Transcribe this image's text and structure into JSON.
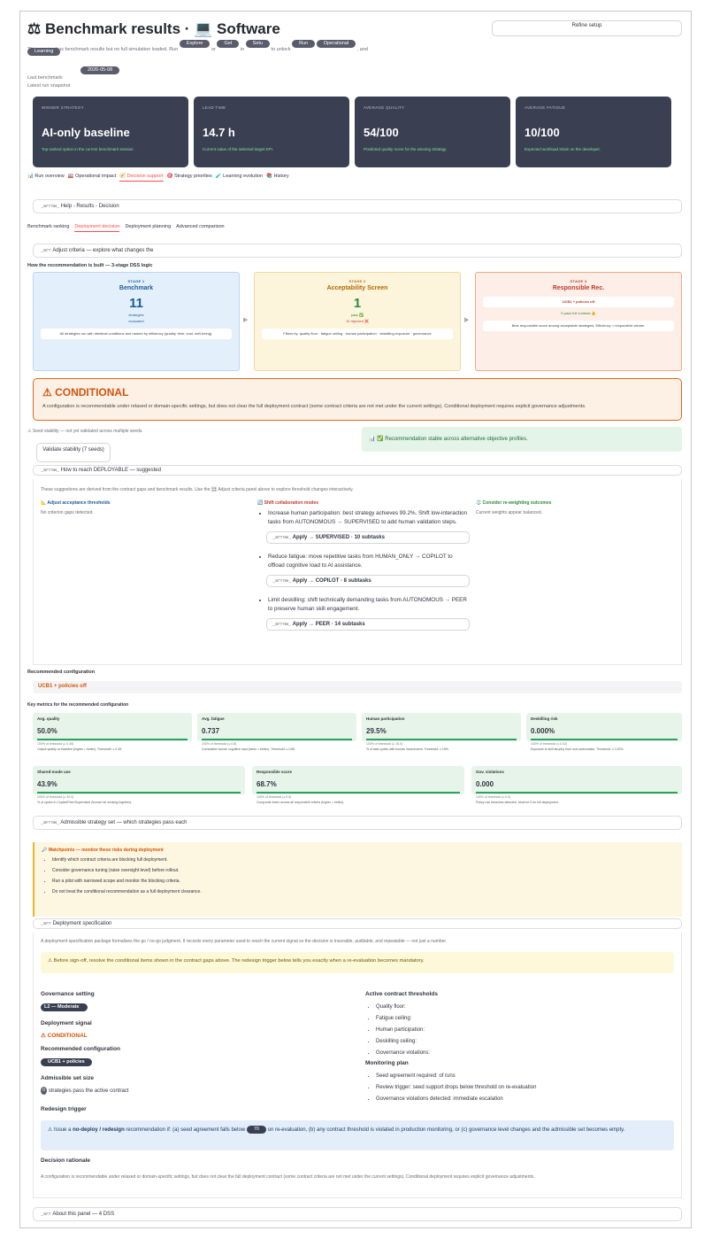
{
  "header": {
    "title": "⚖ Benchmark results · 💻 Software",
    "refine_label": "Refine setup",
    "info_prefix": "This session has benchmark results but no full simulation loaded. Run",
    "info_or": "or",
    "info_in": "in",
    "info_unlock": "to unlock",
    "info_and": ", and",
    "pills": [
      "Explore",
      "Get",
      "Setu",
      "Run",
      "Operational",
      "Learning"
    ],
    "date": "2026-05-08",
    "last_benchmark": "Last benchmark:",
    "latest": "Latest run snapshot"
  },
  "kpis": [
    {
      "label": "WINNER STRATEGY",
      "value": "AI-only baseline",
      "sub": "Top-ranked option in the current benchmark session."
    },
    {
      "label": "LEAD TIME",
      "value": "14.7 h",
      "sub": "Current value of the selected target KPI."
    },
    {
      "label": "AVERAGE QUALITY",
      "value": "54/100",
      "sub": "Predicted quality score for the winning strategy."
    },
    {
      "label": "AVERAGE FATIGUE",
      "value": "10/100",
      "sub": "Expected workload strain on the developer."
    }
  ],
  "main_tabs": [
    "📊 Run overview",
    "🏭 Operational impact",
    "🧭 Decision support",
    "🎯 Strategy priorities",
    "🧪 Learning evolution",
    "📚 History"
  ],
  "exp1": {
    "arrow": "_arrow_",
    "label": "Help - Results - Decision"
  },
  "sub_tabs": [
    "Benchmark ranking",
    "Deployment decision",
    "Deployment planning",
    "Advanced comparison"
  ],
  "exp2": {
    "arrow": "_arr",
    "label": "Adjust criteria — explore what changes the"
  },
  "dss_title": "How the recommendation is built — 3-stage DSS logic",
  "stages": [
    {
      "label": "STAGE 1",
      "name": "Benchmark",
      "num": "11",
      "l1": "strategies",
      "l2": "evaluated",
      "desc": "All strategies run with identical conditions and ranked by efficiency (quality, time, cost, well-being)."
    },
    {
      "label": "STAGE 2",
      "name": "Acceptability Screen",
      "num": "1",
      "l1": "pass ✅",
      "l2": "10 rejected ❌",
      "desc": "Filters by: quality floor · fatigue ceiling · human participation · deskilling exposure · governance"
    },
    {
      "label": "STAGE 3",
      "name": "Responsible Rec.",
      "l1": "UCB1 + policies off",
      "l2": "0 pass full contract ⚠️",
      "desc": "Best responsible score among acceptable strategies. Efficiency × responsible winner."
    }
  ],
  "conditional": {
    "title": "⚠ CONDITIONAL",
    "text": "A configuration is recommendable under relaxed or domain-specific settings, but does not clear the full deployment contract (some contract criteria are not met under the current settings). Conditional deployment requires explicit governance adjustments."
  },
  "seed": {
    "text": "⚠ Seed stability — not yet validated across multiple seeds.",
    "button": "Validate stability (7 seeds)",
    "stable": "📊 ✅ Recommendation stable across alternative objective profiles."
  },
  "exp3": {
    "arrow": "_arrow_",
    "label": "How to reach DEPLOYABLE — suggested"
  },
  "sugg": {
    "intro": "These suggestions are derived from the contract gaps and benchmark results. Use the 🎛 Adjust criteria panel above to explore threshold changes interactively.",
    "c1_title": "📐 Adjust acceptance thresholds",
    "c1_text": "No criterion gaps detected.",
    "c2_title": "🔄 Shift collaboration modes",
    "items": [
      {
        "text": "Increase human participation: best strategy achieves 99.2%. Shift low-interaction tasks from AUTONOMOUS → SUPERVISED to add human validation steps.",
        "exp": "_arrow_",
        "exp_label": "Apply → SUPERVISED · 10 subtasks"
      },
      {
        "text": "Reduce fatigue: move repetitive tasks from HUMAN_ONLY → COPILOT to offload cognitive load to AI assistance.",
        "exp": "_arrow_",
        "exp_label": "Apply → COPILOT · 8 subtasks"
      },
      {
        "text": "Limit deskilling: shift technically demanding tasks from AUTONOMOUS → PEER to preserve human skill engagement.",
        "exp": "_arrow_",
        "exp_label": "Apply → PEER · 14 subtasks"
      }
    ],
    "c3_title": "⚖️ Consider re-weighting outcomes",
    "c3_text": "Current weights appear balanced."
  },
  "rec": {
    "label": "Recommended configuration",
    "value": "UCB1 + policies off",
    "metrics_title": "Key metrics for the recommended configuration"
  },
  "metrics": [
    {
      "label": "Avg. quality",
      "value": "50.0%",
      "th": "100% of threshold (≥ 0.45)",
      "desc": "Output quality vs baseline (higher = better). Threshold: ≥ 0.45."
    },
    {
      "label": "Avg. fatigue",
      "value": "0.737",
      "th": "100% of threshold (≤ 0.8)",
      "desc": "Cumulative human cognitive load (lower = better). Threshold: ≤ 0.80."
    },
    {
      "label": "Human participation",
      "value": "29.5%",
      "th": "100% of threshold (≥ 15.0)",
      "desc": "% of task cycles with human involvement. Threshold: ≥ 15%."
    },
    {
      "label": "Deskilling risk",
      "value": "0.000%",
      "th": "100% of threshold (≤ 0.02)",
      "desc": "Exposure to skill atrophy from over-automation. Threshold: ≤ 0.02%."
    },
    {
      "label": "Shared-mode use",
      "value": "43.9%",
      "th": "100% of threshold (≥ 20.0)",
      "desc": "% of cycles in Copilot/Peer/Supervised (human+AI working together)."
    },
    {
      "label": "Responsible score",
      "value": "68.7%",
      "th": "100% of threshold (≥ 0.5)",
      "desc": "Composite index across all responsible criteria (higher = better)."
    },
    {
      "label": "Gov. violations",
      "value": "0.000",
      "th": "100% of threshold (≤ 0.0)",
      "desc": "Policy rule breaches detected. Must be 0 for full deployment."
    }
  ],
  "exp4": {
    "arrow": "_arrow_",
    "label": "Admissible strategy set — which strategies pass each"
  },
  "watch": {
    "title": "🔎 Watchpoints — monitor these risks during deployment",
    "items": [
      "Identify which contract criteria are blocking full deployment.",
      "Consider governance tuning (raise oversight level) before rollout.",
      "Run a pilot with narrowed scope and monitor the blocking criteria.",
      "Do not treat the conditional recommendation as a full deployment clearance."
    ]
  },
  "exp5": {
    "arrow": "_arr",
    "label": "Deployment specification"
  },
  "spec": {
    "intro": "A deployment specification package formalises the go / no-go judgment. It records every parameter used to reach the current signal so the decision is traceable, auditable, and repeatable — not just a number.",
    "warn": "⚠ Before sign-off, resolve the conditional items shown in the contract gaps above. The redesign trigger below tells you exactly when a re-evaluation becomes mandatory.",
    "gov_label": "Governance setting",
    "gov_value": "L2 — Moderate",
    "signal_label": "Deployment signal",
    "signal_value": "⚠ CONDITIONAL",
    "recc_label": "Recommended configuration",
    "recc_value": "UCB1 + policies",
    "adm_label": "Admissible set size",
    "adm_num": "0",
    "adm_text": "strategies pass the active contract",
    "thr_label": "Active contract thresholds",
    "thr": [
      "Quality floor:",
      "Fatigue ceiling:",
      "Human participation:",
      "Deskilling ceiling:",
      "Governance violations:"
    ],
    "mon_label": "Monitoring plan",
    "mon": [
      "Seed agreement required:",
      "Review trigger: seed support drops below threshold on re-evaluation",
      "Governance violations detected: immediate escalation"
    ],
    "of_runs": "of runs",
    "trigger_label": "Redesign trigger",
    "trigger_a": "Issue a ",
    "trigger_b": "no-deploy / redesign",
    "trigger_c": " recommendation if: (a) seed agreement falls below ",
    "trigger_num": "70",
    "trigger_d": " on re-evaluation, (b) any contract threshold is violated in production monitoring, or (c) governance level changes and the admissible set becomes empty.",
    "rat_label": "Decision rationale",
    "rat_text": "A configuration is recommendable under relaxed or domain-specific settings, but does not clear the full deployment contract (some contract criteria are not met under the current settings). Conditional deployment requires explicit governance adjustments."
  },
  "exp6": {
    "arrow": "_arr",
    "label": "About this panel — 4 DSS"
  },
  "colors": {
    "card": "#3a4052",
    "accent": "#ff4b4b",
    "green": "#29a35c"
  }
}
